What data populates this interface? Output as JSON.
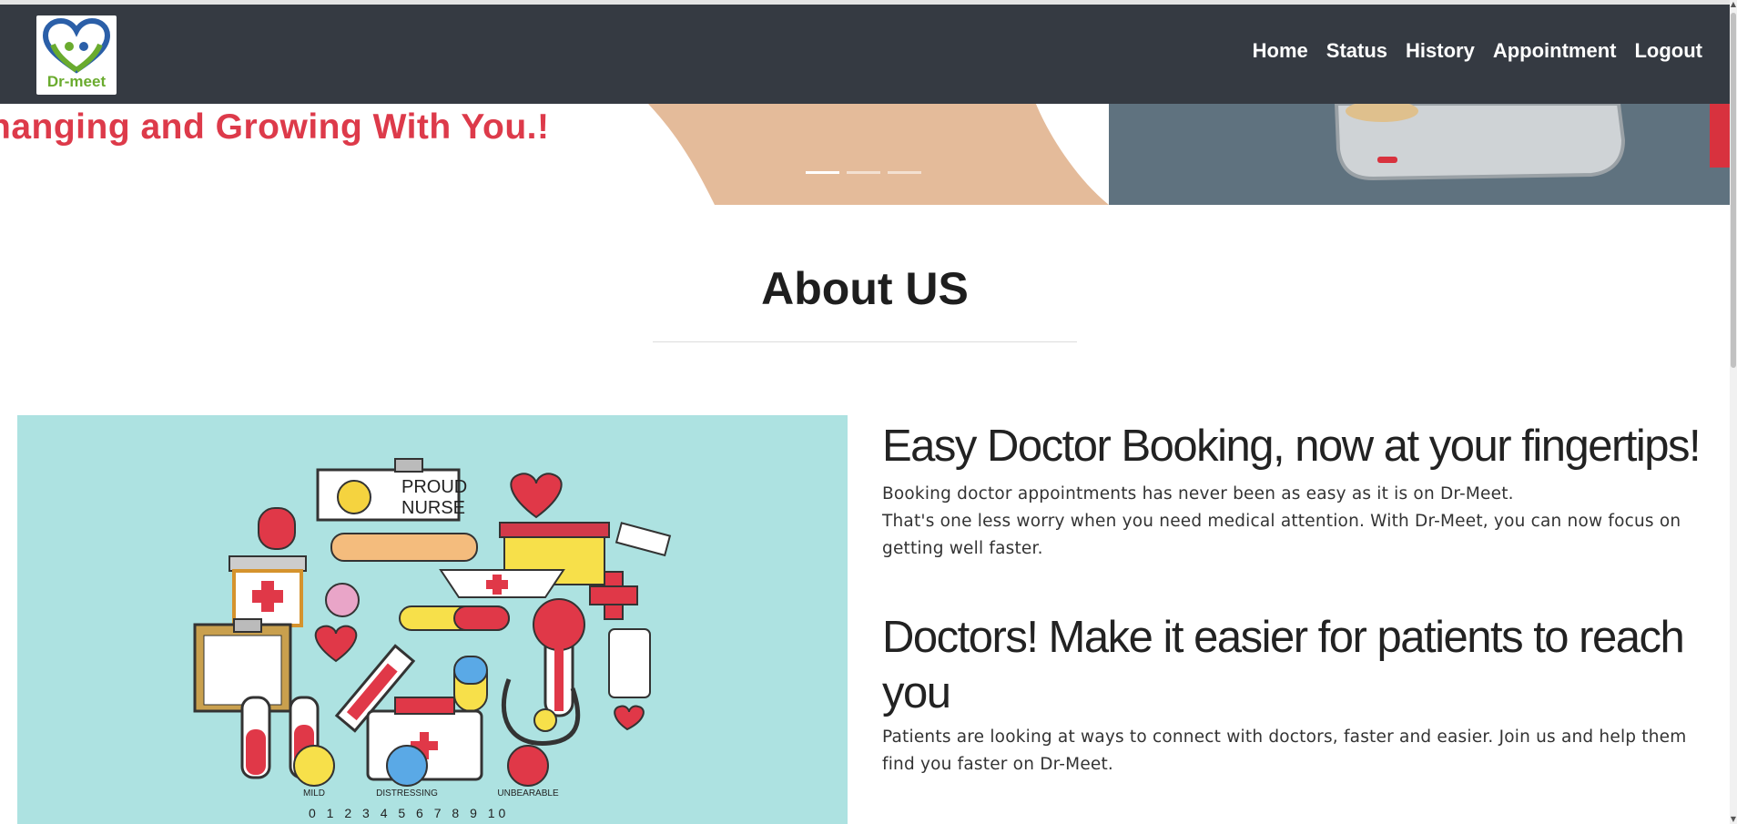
{
  "brand": {
    "logo_text": "Dr-meet",
    "accent": "#dd3a4a",
    "nav_bg": "#353a42",
    "logo_green": "#6aab2e"
  },
  "nav": {
    "items": [
      {
        "label": "Home"
      },
      {
        "label": "Status"
      },
      {
        "label": "History"
      },
      {
        "label": "Appointment"
      },
      {
        "label": "Logout"
      }
    ]
  },
  "hero": {
    "tagline": "hanging and Growing With You.!",
    "slides_count": 3,
    "active_slide": 1
  },
  "about": {
    "title": "About US",
    "section1": {
      "heading": "Easy Doctor Booking, now at your fingertips!",
      "line1": "Booking doctor appointments has never been as easy as it is on Dr-Meet.",
      "line2": "That's one less worry when you need medical attention. With Dr-Meet, you can now focus on getting well faster."
    },
    "section2": {
      "heading": "Doctors! Make it easier for patients to reach you",
      "text": "Patients are looking at ways to connect with doctors, faster and easier. Join us and help them find you faster on Dr-Meet."
    },
    "illustration": {
      "sign_line1": "PROUD",
      "sign_line2": "NURSE",
      "scale_labels": [
        "MILD",
        "DISTRESSING",
        "UNBEARABLE"
      ],
      "scale_numbers": "0 1 2 3 4 5 6 7 8 9 10"
    }
  }
}
